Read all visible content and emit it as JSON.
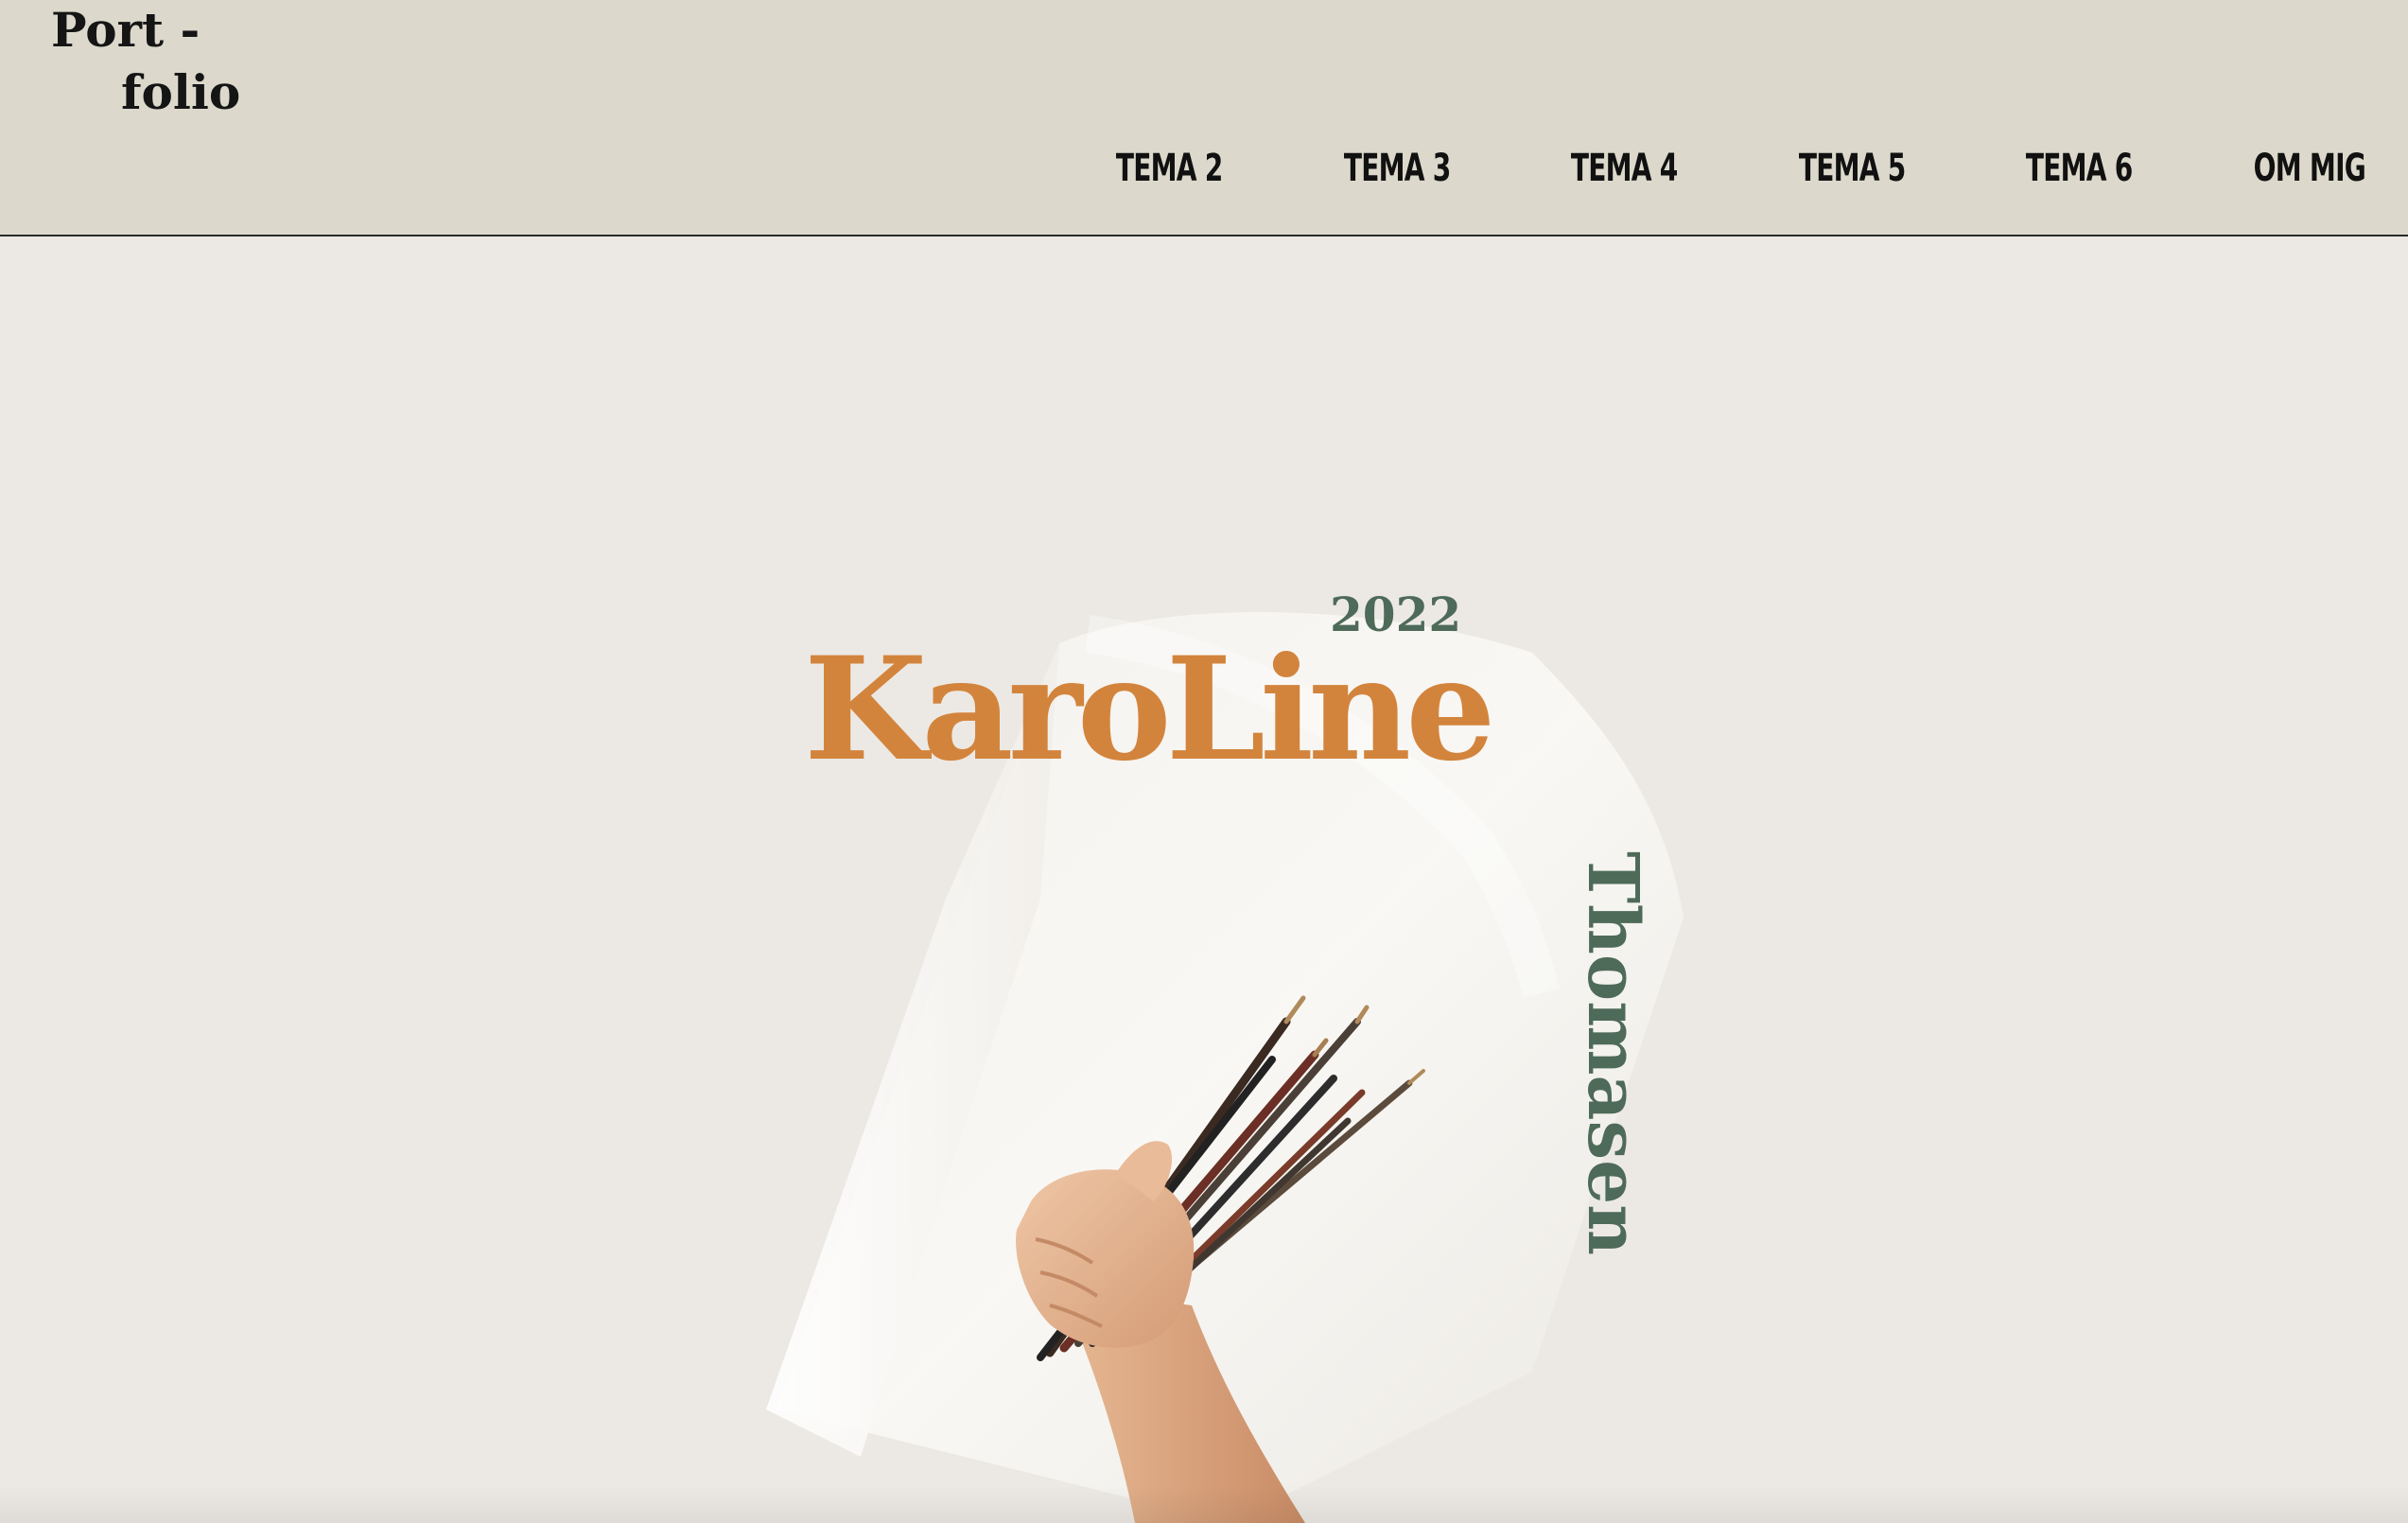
{
  "header": {
    "logo": {
      "line1": "Port -",
      "line2": "folio"
    },
    "nav": [
      {
        "label": "TEMA 2"
      },
      {
        "label": "TEMA 3"
      },
      {
        "label": "TEMA 4"
      },
      {
        "label": "TEMA 5"
      },
      {
        "label": "TEMA 6"
      },
      {
        "label": "OM MIG"
      }
    ]
  },
  "hero": {
    "year": "2022",
    "first_name": "KaroLine",
    "last_name": "Thomasen",
    "image": "hand-holding-paintbrushes-photo"
  },
  "colors": {
    "header_bg": "#dcd9cc",
    "page_bg": "#ece9e4",
    "accent_orange": "#d3843c",
    "accent_green": "#4e6a58",
    "text_dark": "#111111"
  }
}
